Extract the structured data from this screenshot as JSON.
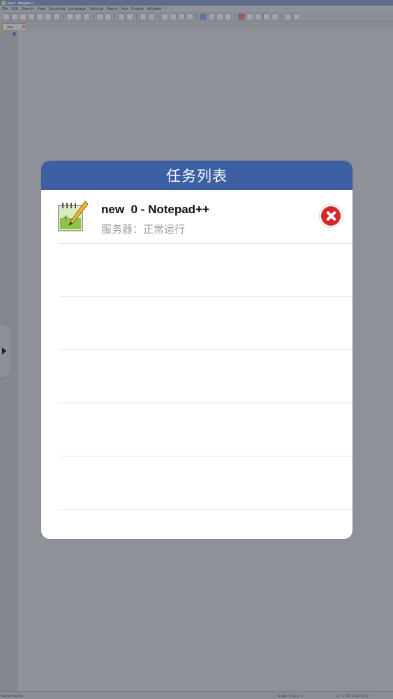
{
  "background_app": {
    "window_title": "new  0 - Notepad++",
    "menu": [
      "File",
      "Edit",
      "Search",
      "View",
      "Encoding",
      "Language",
      "Settings",
      "Macro",
      "Run",
      "Plugins",
      "Window",
      "?"
    ],
    "tab_label": "new",
    "status": {
      "left": "Normal text file",
      "mid": "length : 0    lines : 1",
      "right": "Ln : 1    Col : 1    Sel : 0 | 0"
    }
  },
  "task_list": {
    "title": "任务列表",
    "items": [
      {
        "name": "new  0 - Notepad++",
        "status": "服务器：正常运行",
        "icon": "notepadpp-icon"
      }
    ]
  },
  "colors": {
    "header": "#3d5fa3",
    "close_button": "#d22a2a",
    "overlay": "#8d8f96"
  }
}
